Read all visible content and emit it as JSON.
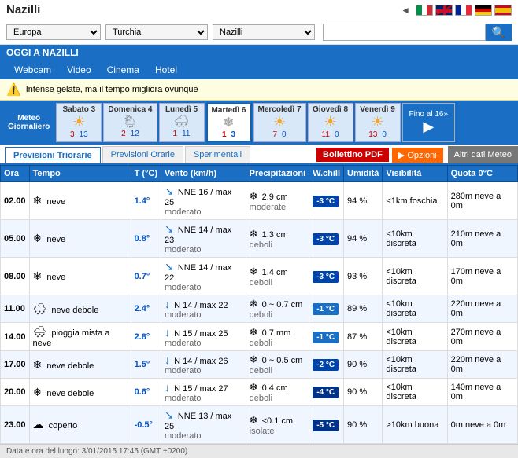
{
  "header": {
    "title": "Nazilli",
    "back_arrow": "◄",
    "flags": [
      "IT",
      "GB",
      "FR",
      "DE",
      "ES"
    ]
  },
  "nav": {
    "dropdowns": [
      "Europa",
      "Turchia",
      "Nazilli"
    ],
    "search_placeholder": ""
  },
  "today_banner": "OGGI A NAZILLI",
  "sub_nav": [
    "Webcam",
    "Video",
    "Cinema",
    "Hotel"
  ],
  "alert": {
    "icon": "⚠",
    "text": "Intense gelate, ma il tempo migliora ovunque"
  },
  "days": [
    {
      "name": "Sabato 3",
      "hi": "3",
      "lo": "13",
      "icon": "☀"
    },
    {
      "name": "Domenica 4",
      "hi": "2",
      "lo": "12",
      "icon": "🌧"
    },
    {
      "name": "Lunedì 5",
      "hi": "1",
      "lo": "11",
      "icon": "🌧"
    },
    {
      "name": "Martedì 6",
      "hi": "1",
      "lo": "3",
      "icon": "❄",
      "active": true
    },
    {
      "name": "Mercoledì 7",
      "hi": "7",
      "lo": "0",
      "icon": "☀"
    },
    {
      "name": "Giovedì 8",
      "hi": "11",
      "lo": "0",
      "icon": "☀"
    },
    {
      "name": "Venerdì 9",
      "hi": "13",
      "lo": "0",
      "icon": "☀"
    }
  ],
  "fino_al": "Fino al 16»",
  "tabs": {
    "items": [
      "Previsioni Triorarie",
      "Previsioni Orarie",
      "Sperimentali"
    ],
    "active": 0,
    "btn_pdf": "Bollettino PDF",
    "btn_opzioni": "▶ Opzioni",
    "btn_altri": "Altri dati Meteo"
  },
  "table": {
    "headers": [
      "Ora",
      "Tempo",
      "T (°C)",
      "Vento (km/h)",
      "Precipitazioni",
      "W.chill",
      "Umidità",
      "Visibilità",
      "Quota 0°C"
    ],
    "rows": [
      {
        "ora": "02.00",
        "tempo_icon": "❄",
        "tempo": "neve",
        "temp": "1.4°",
        "wind_dir": "↘",
        "wind": "NNE 16 / max 25",
        "wind_desc": "moderato",
        "precip_icon": "❄",
        "precip": "2.9 cm",
        "precip_desc": "moderate",
        "wchill": "-3 °C",
        "umid": "94 %",
        "visib": "<1km foschia",
        "quota": "280m neve a 0m"
      },
      {
        "ora": "05.00",
        "tempo_icon": "❄",
        "tempo": "neve",
        "temp": "0.8°",
        "wind_dir": "↘",
        "wind": "NNE 14 / max 23",
        "wind_desc": "moderato",
        "precip_icon": "❄",
        "precip": "1.3 cm",
        "precip_desc": "deboli",
        "wchill": "-3 °C",
        "umid": "94 %",
        "visib": "<10km discreta",
        "quota": "210m neve a 0m"
      },
      {
        "ora": "08.00",
        "tempo_icon": "❄",
        "tempo": "neve",
        "temp": "0.7°",
        "wind_dir": "↘",
        "wind": "NNE 14 / max 22",
        "wind_desc": "moderato",
        "precip_icon": "❄",
        "precip": "1.4 cm",
        "precip_desc": "deboli",
        "wchill": "-3 °C",
        "umid": "93 %",
        "visib": "<10km discreta",
        "quota": "170m neve a 0m"
      },
      {
        "ora": "11.00",
        "tempo_icon": "🌨",
        "tempo": "neve debole",
        "temp": "2.4°",
        "wind_dir": "↓",
        "wind": "N 14 / max 22",
        "wind_desc": "moderato",
        "precip_icon": "❄",
        "precip": "0 ~ 0.7 cm",
        "precip_desc": "deboli",
        "wchill": "-1 °C",
        "umid": "89 %",
        "visib": "<10km discreta",
        "quota": "220m neve a 0m"
      },
      {
        "ora": "14.00",
        "tempo_icon": "🌨",
        "tempo": "pioggia mista a neve",
        "temp": "2.8°",
        "wind_dir": "↓",
        "wind": "N 15 / max 25",
        "wind_desc": "moderato",
        "precip_icon": "❄",
        "precip": "0.7 mm",
        "precip_desc": "deboli",
        "wchill": "-1 °C",
        "umid": "87 %",
        "visib": "<10km discreta",
        "quota": "270m neve a 0m"
      },
      {
        "ora": "17.00",
        "tempo_icon": "❄",
        "tempo": "neve debole",
        "temp": "1.5°",
        "wind_dir": "↓",
        "wind": "N 14 / max 26",
        "wind_desc": "moderato",
        "precip_icon": "❄",
        "precip": "0 ~ 0.5 cm",
        "precip_desc": "deboli",
        "wchill": "-2 °C",
        "umid": "90 %",
        "visib": "<10km discreta",
        "quota": "220m neve a 0m"
      },
      {
        "ora": "20.00",
        "tempo_icon": "❄",
        "tempo": "neve debole",
        "temp": "0.6°",
        "wind_dir": "↓",
        "wind": "N 15 / max 27",
        "wind_desc": "moderato",
        "precip_icon": "❄",
        "precip": "0.4 cm",
        "precip_desc": "deboli",
        "wchill": "-4 °C",
        "umid": "90 %",
        "visib": "<10km discreta",
        "quota": "140m neve a 0m"
      },
      {
        "ora": "23.00",
        "tempo_icon": "☁",
        "tempo": "coperto",
        "temp": "-0.5°",
        "wind_dir": "↘",
        "wind": "NNE 13 / max 25",
        "wind_desc": "moderato",
        "precip_icon": "❄",
        "precip": "<0.1 cm",
        "precip_desc": "isolate",
        "wchill": "-5 °C",
        "umid": "90 %",
        "visib": ">10km buona",
        "quota": "0m neve a 0m"
      }
    ]
  },
  "footer": "Data e ora del luogo: 3/01/2015 17:45 (GMT +0200)"
}
